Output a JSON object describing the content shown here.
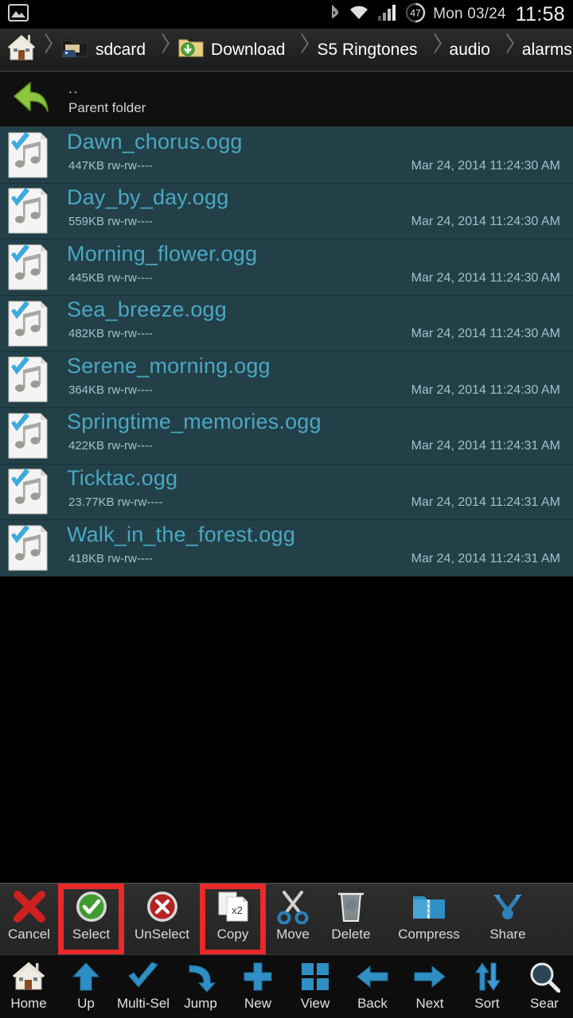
{
  "status_bar": {
    "left_icons": [
      "image-icon"
    ],
    "right_icons": [
      "bluetooth-icon",
      "wifi-icon",
      "signal-icon",
      "battery-icon"
    ],
    "battery_percent": "47",
    "date": "Mon 03/24",
    "time": "11:58"
  },
  "breadcrumb": {
    "home_icon": "home-icon",
    "items": [
      {
        "label": "sdcard",
        "icon": "sdcard-folder-icon"
      },
      {
        "label": "Download",
        "icon": "download-folder-icon"
      },
      {
        "label": "S5 Ringtones",
        "icon": ""
      },
      {
        "label": "audio",
        "icon": ""
      },
      {
        "label": "alarms",
        "icon": ""
      }
    ]
  },
  "parent_row": {
    "icon": "back-arrow-icon",
    "dots": "..",
    "label": "Parent folder"
  },
  "files": [
    {
      "name": "Dawn_chorus.ogg",
      "size": "447KB",
      "perms": "rw-rw----",
      "date": "Mar 24, 2014 11:24:30 AM",
      "icon": "audio-file-icon",
      "selected": true
    },
    {
      "name": "Day_by_day.ogg",
      "size": "559KB",
      "perms": "rw-rw----",
      "date": "Mar 24, 2014 11:24:30 AM",
      "icon": "audio-file-icon",
      "selected": true
    },
    {
      "name": "Morning_flower.ogg",
      "size": "445KB",
      "perms": "rw-rw----",
      "date": "Mar 24, 2014 11:24:30 AM",
      "icon": "audio-file-icon",
      "selected": true
    },
    {
      "name": "Sea_breeze.ogg",
      "size": "482KB",
      "perms": "rw-rw----",
      "date": "Mar 24, 2014 11:24:30 AM",
      "icon": "audio-file-icon",
      "selected": true
    },
    {
      "name": "Serene_morning.ogg",
      "size": "364KB",
      "perms": "rw-rw----",
      "date": "Mar 24, 2014 11:24:30 AM",
      "icon": "audio-file-icon",
      "selected": true
    },
    {
      "name": "Springtime_memories.ogg",
      "size": "422KB",
      "perms": "rw-rw----",
      "date": "Mar 24, 2014 11:24:31 AM",
      "icon": "audio-file-icon",
      "selected": true
    },
    {
      "name": "Ticktac.ogg",
      "size": "23.77KB",
      "perms": "rw-rw----",
      "date": "Mar 24, 2014 11:24:31 AM",
      "icon": "audio-file-icon",
      "selected": true
    },
    {
      "name": "Walk_in_the_forest.ogg",
      "size": "418KB",
      "perms": "rw-rw----",
      "date": "Mar 24, 2014 11:24:31 AM",
      "icon": "audio-file-icon",
      "selected": true
    }
  ],
  "action_bar": {
    "items": [
      {
        "label": "Cancel",
        "icon": "red-x-icon",
        "highlighted": false
      },
      {
        "label": "Select",
        "icon": "green-check-icon",
        "highlighted": true
      },
      {
        "label": "UnSelect",
        "icon": "red-circle-x-icon",
        "highlighted": false
      },
      {
        "label": "Copy",
        "icon": "copy-pages-icon",
        "highlighted": true
      },
      {
        "label": "Move",
        "icon": "scissors-icon",
        "highlighted": false
      },
      {
        "label": "Delete",
        "icon": "trash-icon",
        "highlighted": false
      },
      {
        "label": "Compress",
        "icon": "zip-folder-icon",
        "highlighted": false
      },
      {
        "label": "Share",
        "icon": "share-icon",
        "highlighted": false
      }
    ],
    "copy_badge": "x2"
  },
  "nav_bar": {
    "items": [
      {
        "label": "Home",
        "icon": "home-icon"
      },
      {
        "label": "Up",
        "icon": "arrow-up-icon"
      },
      {
        "label": "Multi-Sel",
        "icon": "check-icon"
      },
      {
        "label": "Jump",
        "icon": "jump-arrow-icon"
      },
      {
        "label": "New",
        "icon": "plus-icon"
      },
      {
        "label": "View",
        "icon": "grid-icon"
      },
      {
        "label": "Back",
        "icon": "arrow-left-icon"
      },
      {
        "label": "Next",
        "icon": "arrow-right-icon"
      },
      {
        "label": "Sort",
        "icon": "sort-icon"
      },
      {
        "label": "Sear",
        "icon": "search-icon"
      }
    ]
  },
  "colors": {
    "row_selected_bg": "#233f47",
    "file_name": "#4aa8c4",
    "highlight_red": "#e82a2a",
    "accent_blue": "#2f8fc4"
  }
}
